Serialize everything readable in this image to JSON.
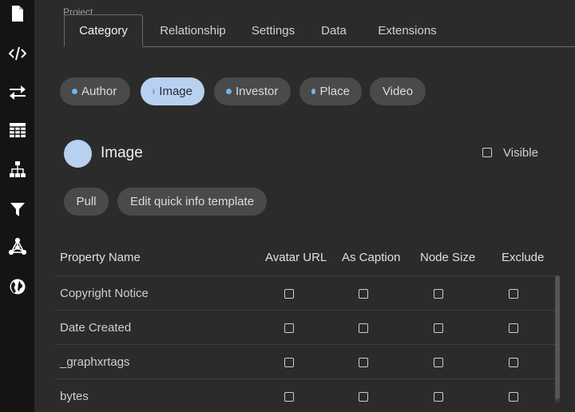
{
  "sidebar": {
    "icons": [
      "file-icon",
      "code-icon",
      "swap-arrows-icon",
      "table-icon",
      "hierarchy-icon",
      "filter-icon",
      "graph-network-icon",
      "globe-icon"
    ]
  },
  "header": {
    "project_label": "Project",
    "tabs": [
      {
        "label": "Category",
        "active": true
      },
      {
        "label": "Relationship",
        "active": false
      },
      {
        "label": "Settings",
        "active": false
      },
      {
        "label": "Data",
        "active": false
      },
      {
        "label": "Extensions",
        "active": false
      }
    ]
  },
  "categories": [
    {
      "label": "Author",
      "has_dot": true,
      "active": false
    },
    {
      "label": "Image",
      "has_dot": true,
      "active": true
    },
    {
      "label": "Investor",
      "has_dot": true,
      "active": false
    },
    {
      "label": "Place",
      "has_dot": true,
      "active": false
    },
    {
      "label": "Video",
      "has_dot": false,
      "active": false
    }
  ],
  "category_detail": {
    "name": "Image",
    "color": "#b9d1f0",
    "visible_label": "Visible",
    "visible_checked": false
  },
  "actions": {
    "pull_label": "Pull",
    "edit_template_label": "Edit quick info template"
  },
  "table": {
    "headers": [
      "Property Name",
      "Avatar URL",
      "As Caption",
      "Node Size",
      "Exclude"
    ],
    "rows": [
      {
        "name": "Copyright Notice",
        "avatar_url": false,
        "as_caption": false,
        "node_size": false,
        "exclude": false
      },
      {
        "name": "Date Created",
        "avatar_url": false,
        "as_caption": false,
        "node_size": false,
        "exclude": false
      },
      {
        "name": "_graphxrtags",
        "avatar_url": false,
        "as_caption": false,
        "node_size": false,
        "exclude": false
      },
      {
        "name": "bytes",
        "avatar_url": false,
        "as_caption": false,
        "node_size": false,
        "exclude": false
      }
    ]
  },
  "colors": {
    "accent": "#b9d1f0",
    "dot": "#6fb4ee",
    "sidebar_bg": "#141414",
    "main_bg": "#2b2b2b"
  }
}
